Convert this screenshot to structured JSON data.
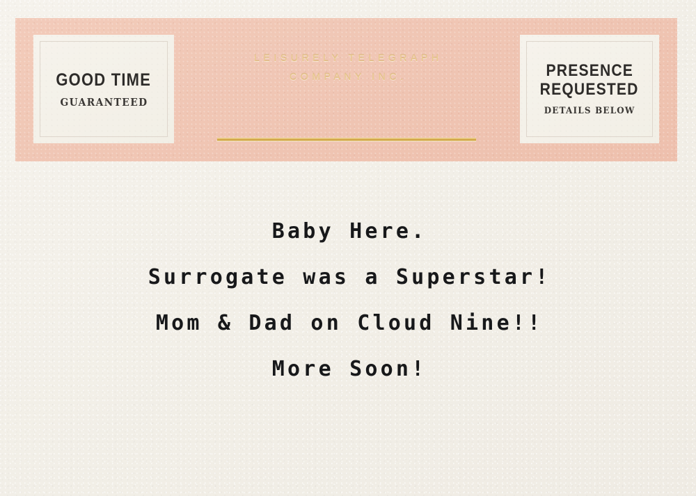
{
  "card": {
    "paper_color": "#f5f2ea",
    "band_color": "#f0c6b4",
    "ink_color": "#17181a",
    "gold_color": "#d9ab45",
    "badge_fill_color": "#f4f1e9"
  },
  "header": {
    "badge_left": {
      "primary": "GOOD TIME",
      "secondary": "GUARANTEED"
    },
    "badge_right": {
      "primary_line_1": "PRESENCE",
      "primary_line_2": "REQUESTED",
      "secondary": "DETAILS BELOW"
    },
    "masthead": {
      "eyebrow_line_1": "LEISURELY TELEGRAPH",
      "eyebrow_line_2": "COMPANY INC.",
      "wordmark": "TELEGRAM"
    }
  },
  "message": {
    "lines": [
      "Baby Here.",
      "Surrogate was a Superstar!",
      "Mom & Dad on Cloud Nine!!",
      "",
      "",
      "More Soon!"
    ],
    "line_0": "Baby Here.",
    "line_1": "Surrogate was a Superstar!",
    "line_2": "Mom & Dad on Cloud Nine!!",
    "line_3": "",
    "line_4": "",
    "line_5": "More Soon!"
  }
}
